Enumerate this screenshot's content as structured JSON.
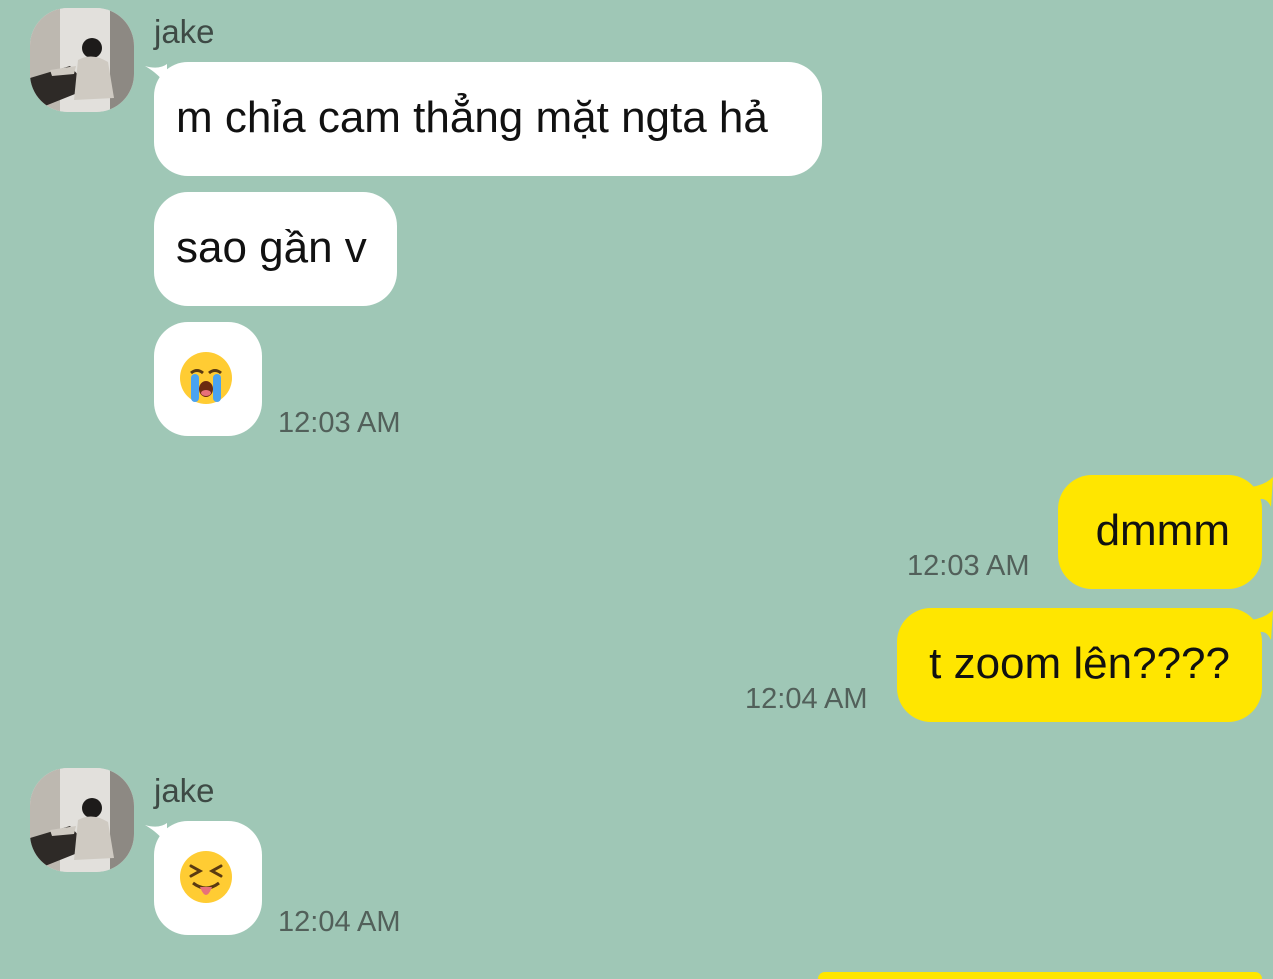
{
  "messages": [
    {
      "sender": "jake",
      "text": "m chỉa cam thẳng mặt ngta hả"
    },
    {
      "text": "sao gần v"
    },
    {
      "emoji": "loudly-crying-face-emoji",
      "time": "12:03 AM"
    },
    {
      "text": "dmmm",
      "time": "12:03 AM"
    },
    {
      "text": "t zoom lên????",
      "time": "12:04 AM"
    },
    {
      "sender": "jake",
      "emoji": "squinting-face-with-tongue-emoji",
      "time": "12:04 AM"
    }
  ],
  "colors": {
    "background": "#9fc7b6",
    "incoming_bubble": "#ffffff",
    "outgoing_bubble": "#ffe600"
  }
}
